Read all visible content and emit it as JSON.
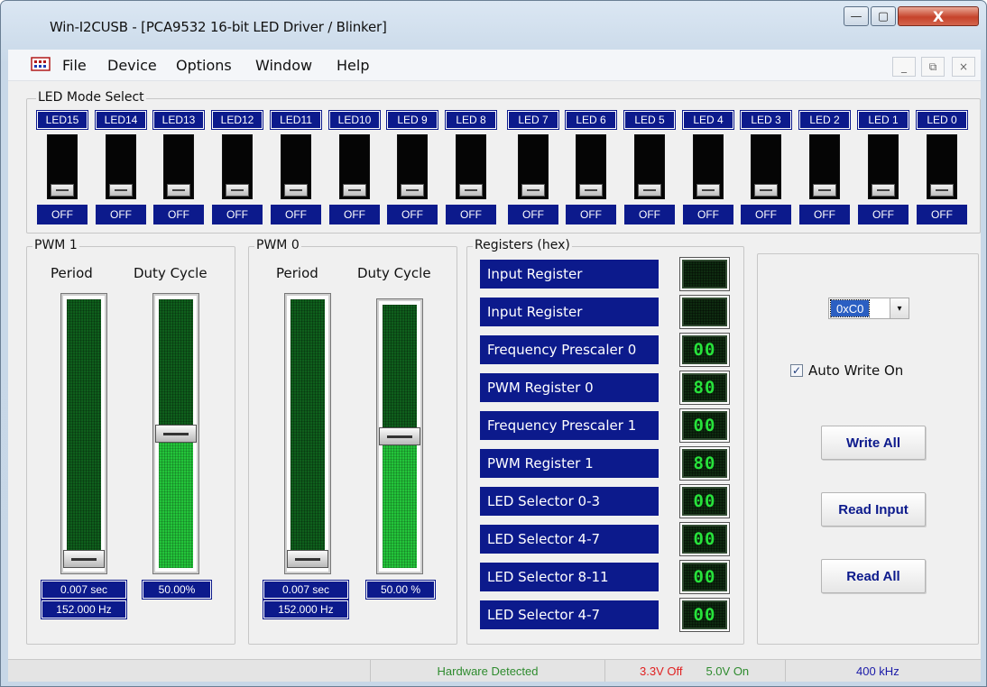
{
  "window": {
    "title": "Win-I2CUSB - [PCA9532 16-bit LED Driver / Blinker]",
    "controls": {
      "minimize": "—",
      "maximize": "▢",
      "close": "X"
    }
  },
  "menubar": {
    "items": [
      "File",
      "Device",
      "Options",
      "Window",
      "Help"
    ],
    "mdi_controls": {
      "minimize": "_",
      "restore": "⧉",
      "close": "×"
    }
  },
  "led_mode": {
    "title": "LED Mode Select",
    "leds": [
      {
        "label": "LED15",
        "state": "OFF"
      },
      {
        "label": "LED14",
        "state": "OFF"
      },
      {
        "label": "LED13",
        "state": "OFF"
      },
      {
        "label": "LED12",
        "state": "OFF"
      },
      {
        "label": "LED11",
        "state": "OFF"
      },
      {
        "label": "LED10",
        "state": "OFF"
      },
      {
        "label": "LED 9",
        "state": "OFF"
      },
      {
        "label": "LED 8",
        "state": "OFF"
      },
      {
        "label": "LED 7",
        "state": "OFF"
      },
      {
        "label": "LED 6",
        "state": "OFF"
      },
      {
        "label": "LED 5",
        "state": "OFF"
      },
      {
        "label": "LED 4",
        "state": "OFF"
      },
      {
        "label": "LED 3",
        "state": "OFF"
      },
      {
        "label": "LED 2",
        "state": "OFF"
      },
      {
        "label": "LED 1",
        "state": "OFF"
      },
      {
        "label": "LED 0",
        "state": "OFF"
      }
    ]
  },
  "pwm1": {
    "title": "PWM 1",
    "period_label": "Period",
    "duty_label": "Duty Cycle",
    "period_value": "0.007 sec",
    "frequency_value": "152.000 Hz",
    "duty_value": "50.00%",
    "period_level": 0.0,
    "duty_level": 0.5
  },
  "pwm0": {
    "title": "PWM 0",
    "period_label": "Period",
    "duty_label": "Duty Cycle",
    "period_value": "0.007 sec",
    "frequency_value": "152.000 Hz",
    "duty_value": "50.00 %",
    "period_level": 0.0,
    "duty_level": 0.5
  },
  "registers": {
    "title": "Registers (hex)",
    "items": [
      {
        "label": "Input Register",
        "value": ""
      },
      {
        "label": "Input Register",
        "value": ""
      },
      {
        "label": "Frequency Prescaler 0",
        "value": "00"
      },
      {
        "label": "PWM Register 0",
        "value": "80"
      },
      {
        "label": "Frequency Prescaler 1",
        "value": "00"
      },
      {
        "label": "PWM Register 1",
        "value": "80"
      },
      {
        "label": "LED Selector 0-3",
        "value": "00"
      },
      {
        "label": "LED Selector 4-7",
        "value": "00"
      },
      {
        "label": "LED Selector 8-11",
        "value": "00"
      },
      {
        "label": "LED Selector 4-7",
        "value": "00"
      }
    ]
  },
  "controls": {
    "address_value": "0xC0",
    "auto_write_label": "Auto Write On",
    "auto_write_checked": true,
    "check_mark": "✓",
    "dropdown_arrow": "▾",
    "write_all_label": "Write All",
    "read_input_label": "Read Input",
    "read_all_label": "Read All"
  },
  "statusbar": {
    "hardware": "Hardware Detected",
    "v33": "3.3V Off",
    "v50": "5.0V On",
    "speed": "400 kHz",
    "colors": {
      "hardware": "#2e8b2e",
      "v33": "#e02020",
      "v50": "#2e8b2e",
      "speed": "#1a1aa8"
    }
  }
}
